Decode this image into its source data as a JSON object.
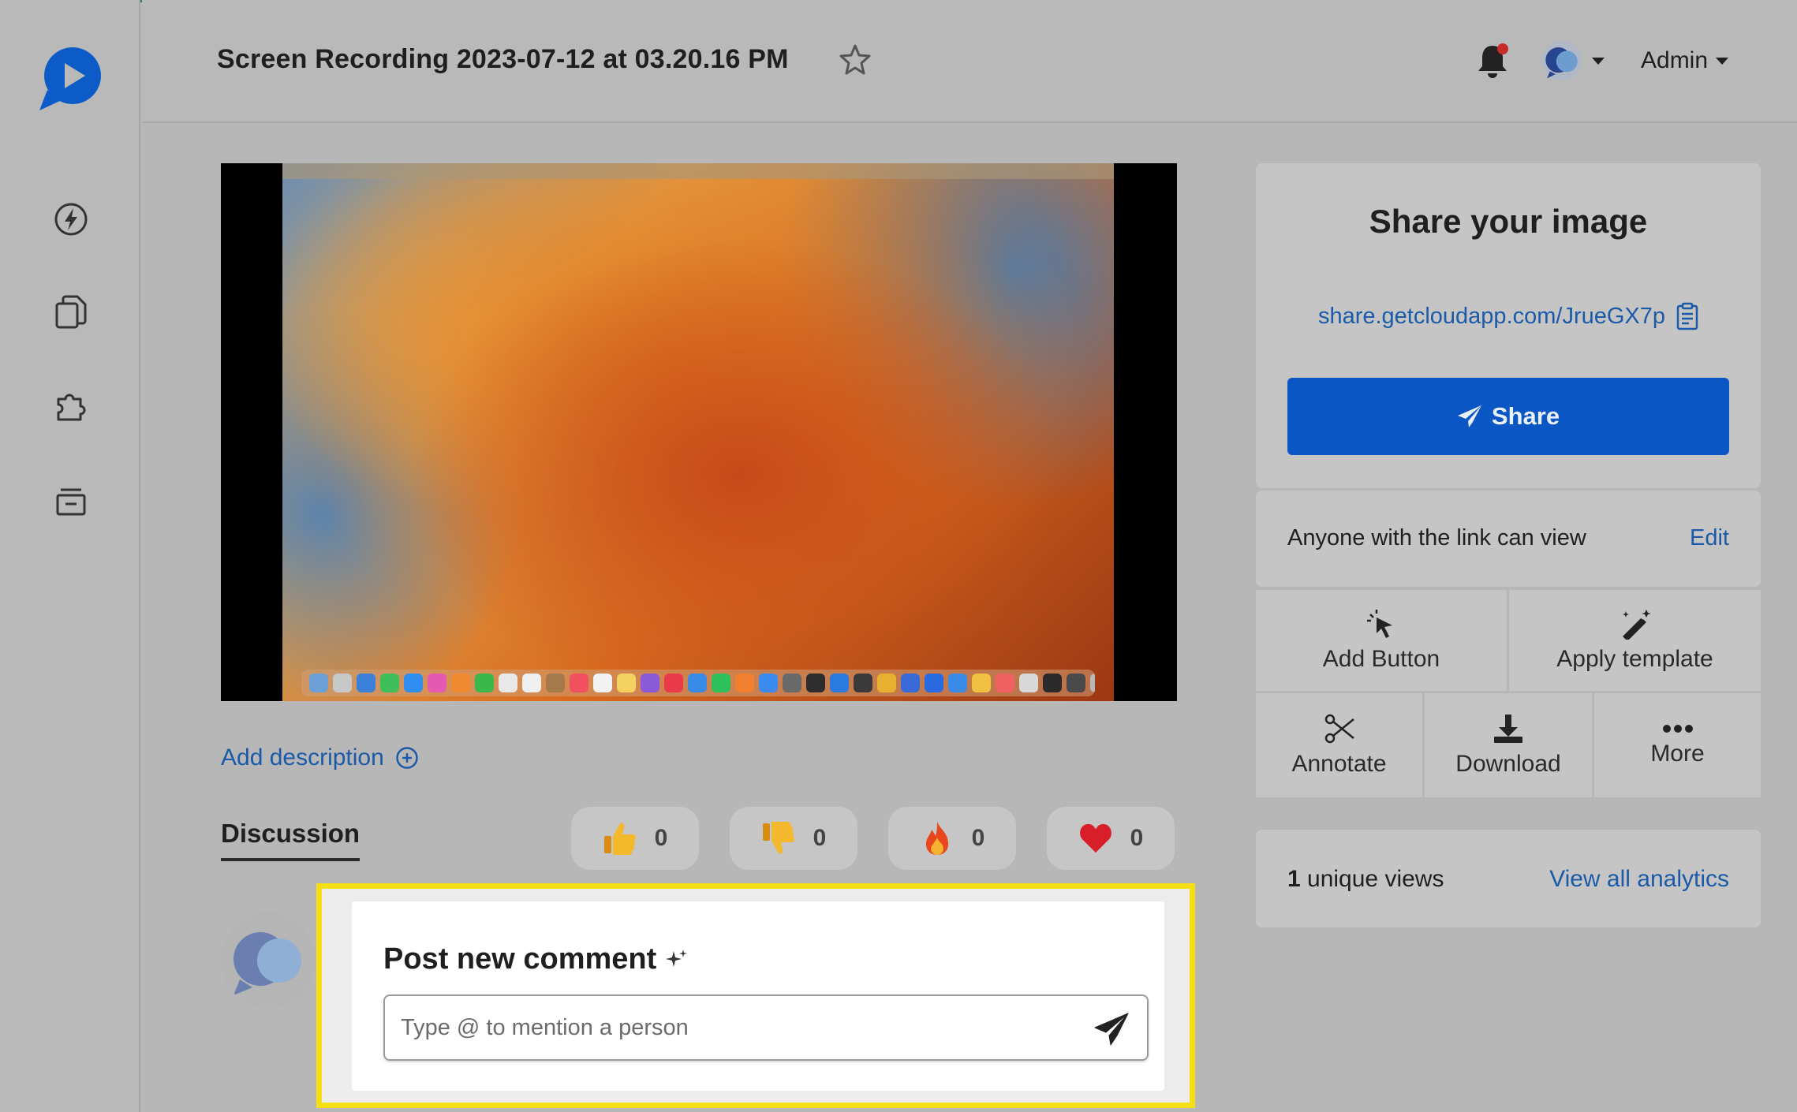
{
  "header": {
    "title": "Screen Recording 2023-07-12 at 03.20.16 PM",
    "user_label": "Admin"
  },
  "sidebar": {
    "items": [
      {
        "icon": "lightning-icon"
      },
      {
        "icon": "documents-icon"
      },
      {
        "icon": "puzzle-icon"
      },
      {
        "icon": "archive-icon"
      }
    ]
  },
  "main": {
    "add_description": "Add description",
    "discussion_label": "Discussion",
    "reactions": [
      {
        "icon": "thumbs-up-emoji",
        "count": "0"
      },
      {
        "icon": "thumbs-down-emoji",
        "count": "0"
      },
      {
        "icon": "fire-emoji",
        "count": "0"
      },
      {
        "icon": "heart-emoji",
        "count": "0"
      }
    ],
    "comment": {
      "title": "Post new comment",
      "placeholder": "Type @ to mention a person"
    }
  },
  "share": {
    "title": "Share your image",
    "link": "share.getcloudapp.com/JrueGX7p",
    "button": "Share",
    "permission": "Anyone with the link can view",
    "edit": "Edit"
  },
  "actions": {
    "add_button": "Add Button",
    "apply_template": "Apply template",
    "annotate": "Annotate",
    "download": "Download",
    "more": "More"
  },
  "analytics": {
    "views_count": "1",
    "views_label": " unique views",
    "link": "View all analytics"
  },
  "colors": {
    "accent": "#0a56c4",
    "link": "#1b5aa8",
    "highlight": "#f5de12"
  }
}
